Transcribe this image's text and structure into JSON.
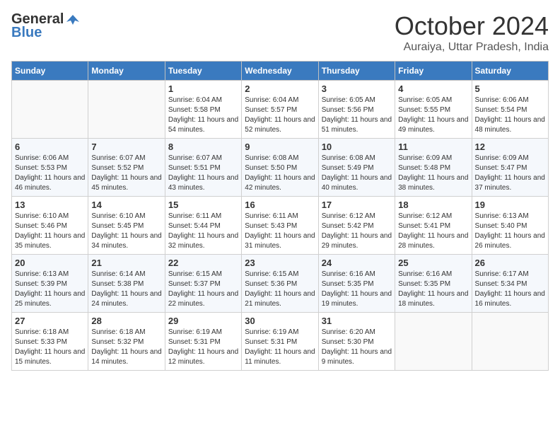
{
  "header": {
    "logo_general": "General",
    "logo_blue": "Blue",
    "month": "October 2024",
    "location": "Auraiya, Uttar Pradesh, India"
  },
  "weekdays": [
    "Sunday",
    "Monday",
    "Tuesday",
    "Wednesday",
    "Thursday",
    "Friday",
    "Saturday"
  ],
  "weeks": [
    [
      {
        "day": "",
        "info": ""
      },
      {
        "day": "",
        "info": ""
      },
      {
        "day": "1",
        "info": "Sunrise: 6:04 AM\nSunset: 5:58 PM\nDaylight: 11 hours and 54 minutes."
      },
      {
        "day": "2",
        "info": "Sunrise: 6:04 AM\nSunset: 5:57 PM\nDaylight: 11 hours and 52 minutes."
      },
      {
        "day": "3",
        "info": "Sunrise: 6:05 AM\nSunset: 5:56 PM\nDaylight: 11 hours and 51 minutes."
      },
      {
        "day": "4",
        "info": "Sunrise: 6:05 AM\nSunset: 5:55 PM\nDaylight: 11 hours and 49 minutes."
      },
      {
        "day": "5",
        "info": "Sunrise: 6:06 AM\nSunset: 5:54 PM\nDaylight: 11 hours and 48 minutes."
      }
    ],
    [
      {
        "day": "6",
        "info": "Sunrise: 6:06 AM\nSunset: 5:53 PM\nDaylight: 11 hours and 46 minutes."
      },
      {
        "day": "7",
        "info": "Sunrise: 6:07 AM\nSunset: 5:52 PM\nDaylight: 11 hours and 45 minutes."
      },
      {
        "day": "8",
        "info": "Sunrise: 6:07 AM\nSunset: 5:51 PM\nDaylight: 11 hours and 43 minutes."
      },
      {
        "day": "9",
        "info": "Sunrise: 6:08 AM\nSunset: 5:50 PM\nDaylight: 11 hours and 42 minutes."
      },
      {
        "day": "10",
        "info": "Sunrise: 6:08 AM\nSunset: 5:49 PM\nDaylight: 11 hours and 40 minutes."
      },
      {
        "day": "11",
        "info": "Sunrise: 6:09 AM\nSunset: 5:48 PM\nDaylight: 11 hours and 38 minutes."
      },
      {
        "day": "12",
        "info": "Sunrise: 6:09 AM\nSunset: 5:47 PM\nDaylight: 11 hours and 37 minutes."
      }
    ],
    [
      {
        "day": "13",
        "info": "Sunrise: 6:10 AM\nSunset: 5:46 PM\nDaylight: 11 hours and 35 minutes."
      },
      {
        "day": "14",
        "info": "Sunrise: 6:10 AM\nSunset: 5:45 PM\nDaylight: 11 hours and 34 minutes."
      },
      {
        "day": "15",
        "info": "Sunrise: 6:11 AM\nSunset: 5:44 PM\nDaylight: 11 hours and 32 minutes."
      },
      {
        "day": "16",
        "info": "Sunrise: 6:11 AM\nSunset: 5:43 PM\nDaylight: 11 hours and 31 minutes."
      },
      {
        "day": "17",
        "info": "Sunrise: 6:12 AM\nSunset: 5:42 PM\nDaylight: 11 hours and 29 minutes."
      },
      {
        "day": "18",
        "info": "Sunrise: 6:12 AM\nSunset: 5:41 PM\nDaylight: 11 hours and 28 minutes."
      },
      {
        "day": "19",
        "info": "Sunrise: 6:13 AM\nSunset: 5:40 PM\nDaylight: 11 hours and 26 minutes."
      }
    ],
    [
      {
        "day": "20",
        "info": "Sunrise: 6:13 AM\nSunset: 5:39 PM\nDaylight: 11 hours and 25 minutes."
      },
      {
        "day": "21",
        "info": "Sunrise: 6:14 AM\nSunset: 5:38 PM\nDaylight: 11 hours and 24 minutes."
      },
      {
        "day": "22",
        "info": "Sunrise: 6:15 AM\nSunset: 5:37 PM\nDaylight: 11 hours and 22 minutes."
      },
      {
        "day": "23",
        "info": "Sunrise: 6:15 AM\nSunset: 5:36 PM\nDaylight: 11 hours and 21 minutes."
      },
      {
        "day": "24",
        "info": "Sunrise: 6:16 AM\nSunset: 5:35 PM\nDaylight: 11 hours and 19 minutes."
      },
      {
        "day": "25",
        "info": "Sunrise: 6:16 AM\nSunset: 5:35 PM\nDaylight: 11 hours and 18 minutes."
      },
      {
        "day": "26",
        "info": "Sunrise: 6:17 AM\nSunset: 5:34 PM\nDaylight: 11 hours and 16 minutes."
      }
    ],
    [
      {
        "day": "27",
        "info": "Sunrise: 6:18 AM\nSunset: 5:33 PM\nDaylight: 11 hours and 15 minutes."
      },
      {
        "day": "28",
        "info": "Sunrise: 6:18 AM\nSunset: 5:32 PM\nDaylight: 11 hours and 14 minutes."
      },
      {
        "day": "29",
        "info": "Sunrise: 6:19 AM\nSunset: 5:31 PM\nDaylight: 11 hours and 12 minutes."
      },
      {
        "day": "30",
        "info": "Sunrise: 6:19 AM\nSunset: 5:31 PM\nDaylight: 11 hours and 11 minutes."
      },
      {
        "day": "31",
        "info": "Sunrise: 6:20 AM\nSunset: 5:30 PM\nDaylight: 11 hours and 9 minutes."
      },
      {
        "day": "",
        "info": ""
      },
      {
        "day": "",
        "info": ""
      }
    ]
  ]
}
